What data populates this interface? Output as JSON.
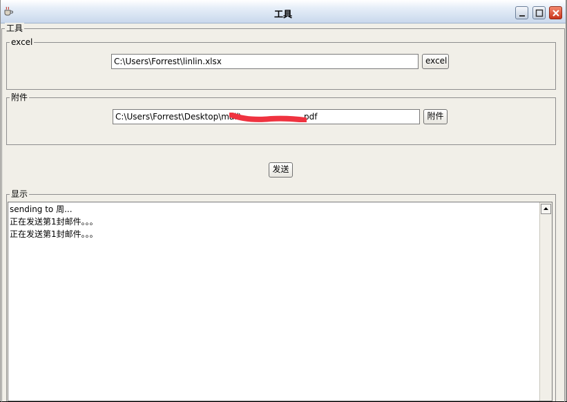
{
  "window": {
    "title": "工具",
    "controls": {
      "minimize": "minimize",
      "maximize": "maximize",
      "close": "close"
    }
  },
  "main_group": {
    "legend": "工具"
  },
  "excel_group": {
    "legend": "excel",
    "path_value": "C:\\Users\\Forrest\\linlin.xlsx",
    "button_label": "excel"
  },
  "attachment_group": {
    "legend": "附件",
    "path_value_visible_prefix": "C:\\Users\\Forrest\\Desktop\\mail\\",
    "path_value_visible_suffix": "pdf",
    "button_label": "附件"
  },
  "send_button": {
    "label": "发送"
  },
  "display_group": {
    "legend": "显示",
    "log_lines": [
      "sending to 周...",
      "正在发送第1封邮件。。。",
      "正在发送第1封邮件。。。"
    ]
  },
  "colors": {
    "window_bg": "#f1efe8",
    "redaction": "#ef3340"
  },
  "icons": {
    "app": "coffee-cup-icon",
    "scroll_up": "arrow-up-icon"
  }
}
